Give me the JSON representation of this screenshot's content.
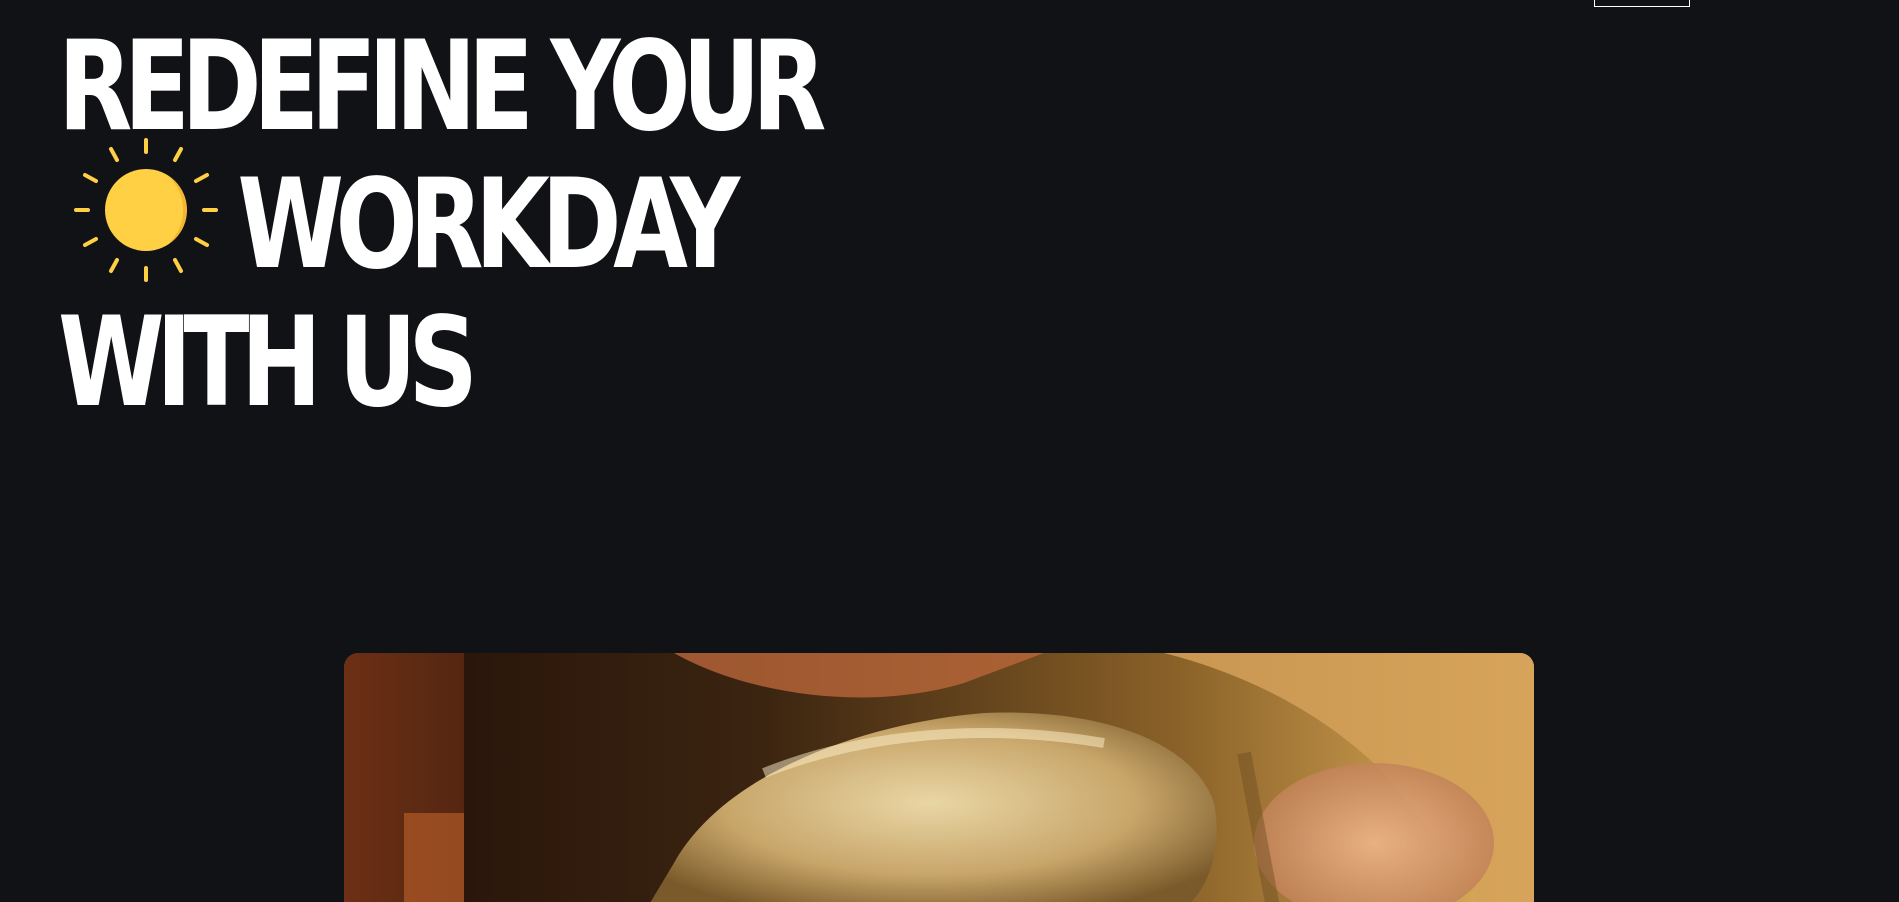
{
  "header": {
    "menu_button_label": ""
  },
  "hero": {
    "line1": "REDEFINE YOUR",
    "line2": "WORKDAY",
    "line3": "WITH US",
    "icon": "sun-icon",
    "icon_color": "#FFCF44"
  },
  "media": {
    "icon": "video-still",
    "dominant_color": "#C88B3A"
  },
  "colors": {
    "background": "#111215",
    "text": "#FFFFFF",
    "accent": "#FFCF44"
  }
}
